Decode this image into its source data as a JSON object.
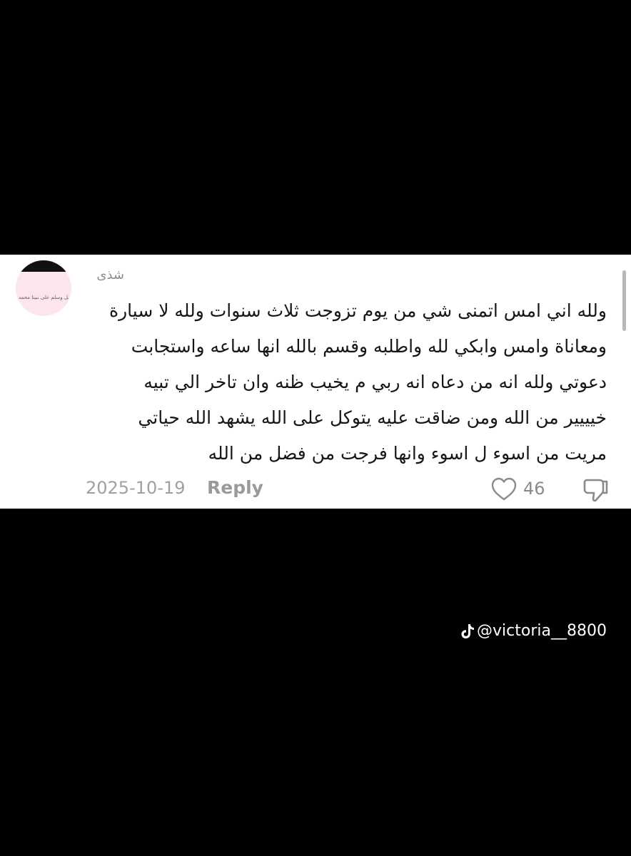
{
  "comment": {
    "avatar_text": "اللهم صل وسلم على نبينا محمد",
    "username": "شذى",
    "lines": [
      "ولله اني امس اتمنى شي من يوم تزوجت ثلاث سنوات ولله لا سيارة",
      "ومعاناة وامس وابكي لله واطلبه وقسم بالله انها ساعه واستجابت",
      "دعوتي ولله انه من دعاه انه ربي م يخيب ظنه وان تاخر الي تبيه",
      "خيييير من الله ومن ضاقت عليه يتوكل على الله يشهد الله حياتي",
      "مريت من اسوء ل اسوء وانها فرجت من فضل من الله"
    ],
    "date": "2025-10-19",
    "reply_label": "Reply",
    "like_count": "46",
    "icons": {
      "like": "heart-icon",
      "dislike": "thumbs-down-icon"
    }
  },
  "watermark": {
    "icon": "tiktok-icon",
    "handle": "@victoria__8800"
  },
  "colors": {
    "background": "#000000",
    "card": "#ffffff",
    "text": "#161616",
    "muted": "#9a9a9a"
  }
}
